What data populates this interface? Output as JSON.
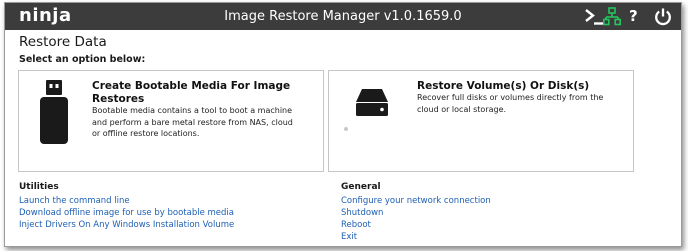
{
  "app": {
    "logo": "ninja",
    "title": "Image Restore Manager v1.0.1659.0",
    "toolbar_icons": [
      "terminal-icon",
      "network-icon",
      "help-icon",
      "power-icon"
    ],
    "help_glyph": "?"
  },
  "page": {
    "title": "Restore Data",
    "subtitle": "Select an option below:"
  },
  "cards": [
    {
      "icon": "usb-drive-icon",
      "title": "Create Bootable Media For Image Restores",
      "description": "Bootable media contains a tool to boot a machine and perform a bare metal restore from NAS, cloud or offline restore locations."
    },
    {
      "icon": "hard-disk-icon",
      "title": "Restore Volume(s) Or Disk(s)",
      "description": "Recover full disks or volumes directly from the cloud or local storage."
    }
  ],
  "utilities": {
    "heading": "Utilities",
    "links": [
      "Launch the command line",
      "Download offline image for use by bootable media",
      "Inject Drivers On Any Windows Installation Volume"
    ]
  },
  "general": {
    "heading": "General",
    "links": [
      "Configure your network connection",
      "Shutdown",
      "Reboot",
      "Exit"
    ]
  },
  "colors": {
    "titlebar": "#3c3c3c",
    "link": "#1e5fb4",
    "network_icon": "#22c55e",
    "card_border": "#c6c6c6"
  }
}
